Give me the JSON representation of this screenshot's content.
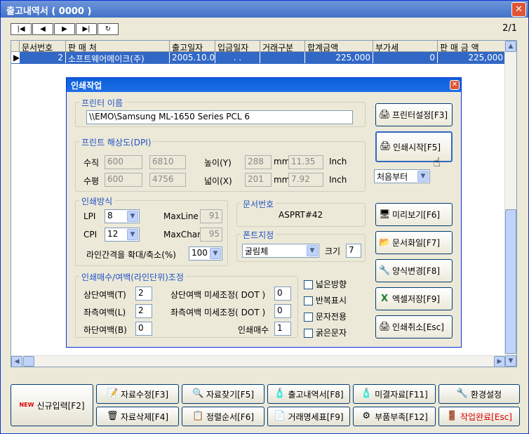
{
  "window": {
    "title": "출고내역서 ( 0000 )"
  },
  "nav": {
    "first": "|◀",
    "prev": "◀",
    "next": "▶",
    "last": "▶|",
    "refresh": "↻",
    "page": "2/1"
  },
  "grid": {
    "columns": [
      "문서번호",
      "판 매 처",
      "출고일자",
      "입금일자",
      "거래구분",
      "합계금액",
      "부가세",
      "판 매 금 액"
    ],
    "row": {
      "no": "2",
      "customer": "소프트웨어메이크(주)",
      "out_date": "2005.10.04",
      "in_date": ". .",
      "type": "",
      "total": "225,000",
      "vat": "0",
      "sales": "225,000"
    }
  },
  "dialog": {
    "title": "인쇄작업",
    "printer_group": "프린터 이름",
    "printer_name": "\\\\EMO\\Samsung ML-1650 Series PCL 6",
    "resolution_group": "프린트 해상도(DPI)",
    "vertical_label": "수직",
    "vertical_v1": "600",
    "vertical_v2": "6810",
    "horizontal_label": "수평",
    "horizontal_v1": "600",
    "horizontal_v2": "4756",
    "height_label": "높이(Y)",
    "height_val": "288",
    "height_mm": "mm",
    "height_inch_val": "11.35",
    "height_inch": "Inch",
    "width_label": "넓이(X)",
    "width_val": "201",
    "width_mm": "mm",
    "width_inch_val": "7.92",
    "width_inch": "Inch",
    "method_group": "인쇄방식",
    "lpi_label": "LPI",
    "lpi": "8",
    "cpi_label": "CPI",
    "cpi": "12",
    "maxline_label": "MaxLine",
    "maxline": "91",
    "maxchar_label": "MaxChar",
    "maxchar": "95",
    "spacing_label": "라인간격을 확대/축소(%)",
    "spacing": "100",
    "docno_group": "문서번호",
    "docno": "ASPRT#42",
    "font_group": "폰트지정",
    "font": "굴림체",
    "size_label": "크기",
    "size": "7",
    "margin_group": "인쇄매수/여백(라인단위)조정",
    "top_label": "상단여백(T)",
    "top": "2",
    "left_label": "좌측여백(L)",
    "left": "2",
    "bottom_label": "하단여백(B)",
    "bottom": "0",
    "top_fine_label": "상단여백 미세조정( DOT )",
    "top_fine": "0",
    "left_fine_label": "좌측여백 미세조정( DOT )",
    "left_fine": "0",
    "copies_label": "인쇄매수",
    "copies": "1",
    "checks": [
      "넓은방향",
      "반복표시",
      "문자전용",
      "굵은문자"
    ],
    "btn_printer": "프린터설정[F3]",
    "btn_print": "인쇄시작[F5]",
    "start_from": "처음부터",
    "btn_preview": "미리보기[F6]",
    "btn_file": "문서화일[F7]",
    "btn_form": "양식변경[F8]",
    "btn_excel": "엑셀저장[F9]",
    "btn_cancel": "인쇄취소[Esc]"
  },
  "bottom": {
    "new": "신규입력[F2]",
    "new_badge": "NEW",
    "b1": "자료수정[F3]",
    "b2": "자료찾기[F5]",
    "b3": "출고내역서[F8]",
    "b4": "미결자료[F11]",
    "b5": "환경설정",
    "b6": "자료삭제[F4]",
    "b7": "정렬순서[F6]",
    "b8": "거래명세표[F9]",
    "b9": "부품부족[F12]",
    "b10": "작업완료[Esc]"
  }
}
